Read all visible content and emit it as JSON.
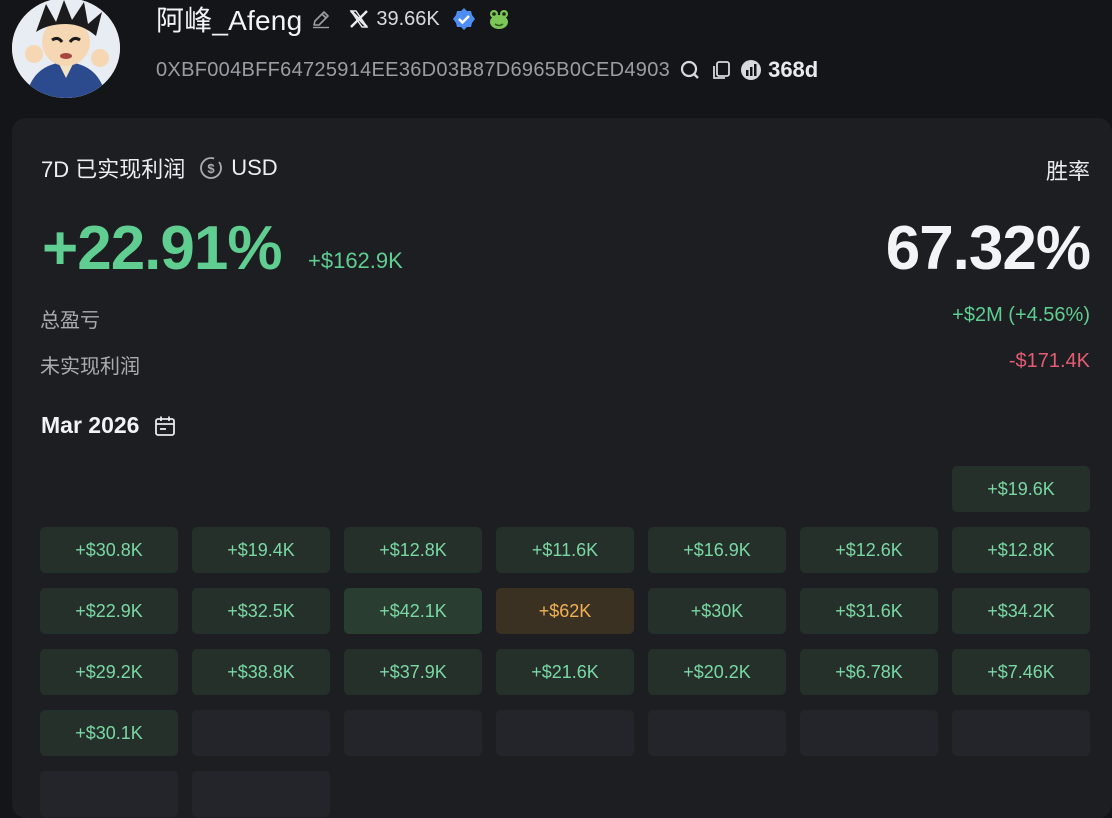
{
  "profile": {
    "name": "阿峰_Afeng",
    "x_followers": "39.66K",
    "address": "0XBF004BFF64725914EE36D03B87D6965B0CED4903",
    "age": "368d"
  },
  "card": {
    "title": "7D 已实现利润",
    "currency": "USD",
    "winrate_label": "胜率",
    "pnl_percent": "+22.91%",
    "pnl_amount": "+$162.9K",
    "winrate": "67.32%",
    "total_pnl_label": "总盈亏",
    "total_pnl_value": "+$2M (+4.56%)",
    "unrealized_label": "未实现利润",
    "unrealized_value": "-$171.4K"
  },
  "calendar": {
    "month": "Mar 2026",
    "rows": [
      [
        "",
        "",
        "",
        "",
        "",
        "",
        "+$19.6K"
      ],
      [
        "+$30.8K",
        "+$19.4K",
        "+$12.8K",
        "+$11.6K",
        "+$16.9K",
        "+$12.6K",
        "+$12.8K"
      ],
      [
        "+$22.9K",
        "+$32.5K",
        "+$42.1K",
        "+$62K",
        "+$30K",
        "+$31.6K",
        "+$34.2K"
      ],
      [
        "+$29.2K",
        "+$38.8K",
        "+$37.9K",
        "+$21.6K",
        "+$20.2K",
        "+$6.78K",
        "+$7.46K"
      ],
      [
        "+$30.1K",
        "",
        "",
        "",
        "",
        "",
        ""
      ],
      [
        "",
        "",
        "",
        "",
        "",
        "",
        ""
      ]
    ]
  },
  "colors": {
    "positive": "#5fce90",
    "negative": "#e45b74",
    "best_day": "#f1b154",
    "verified": "#4c8df6"
  },
  "icons": [
    "edit-icon",
    "x-icon",
    "verified-icon",
    "frog-icon",
    "search-icon",
    "copy-icon",
    "chart-icon",
    "usd-icon",
    "calendar-icon"
  ]
}
